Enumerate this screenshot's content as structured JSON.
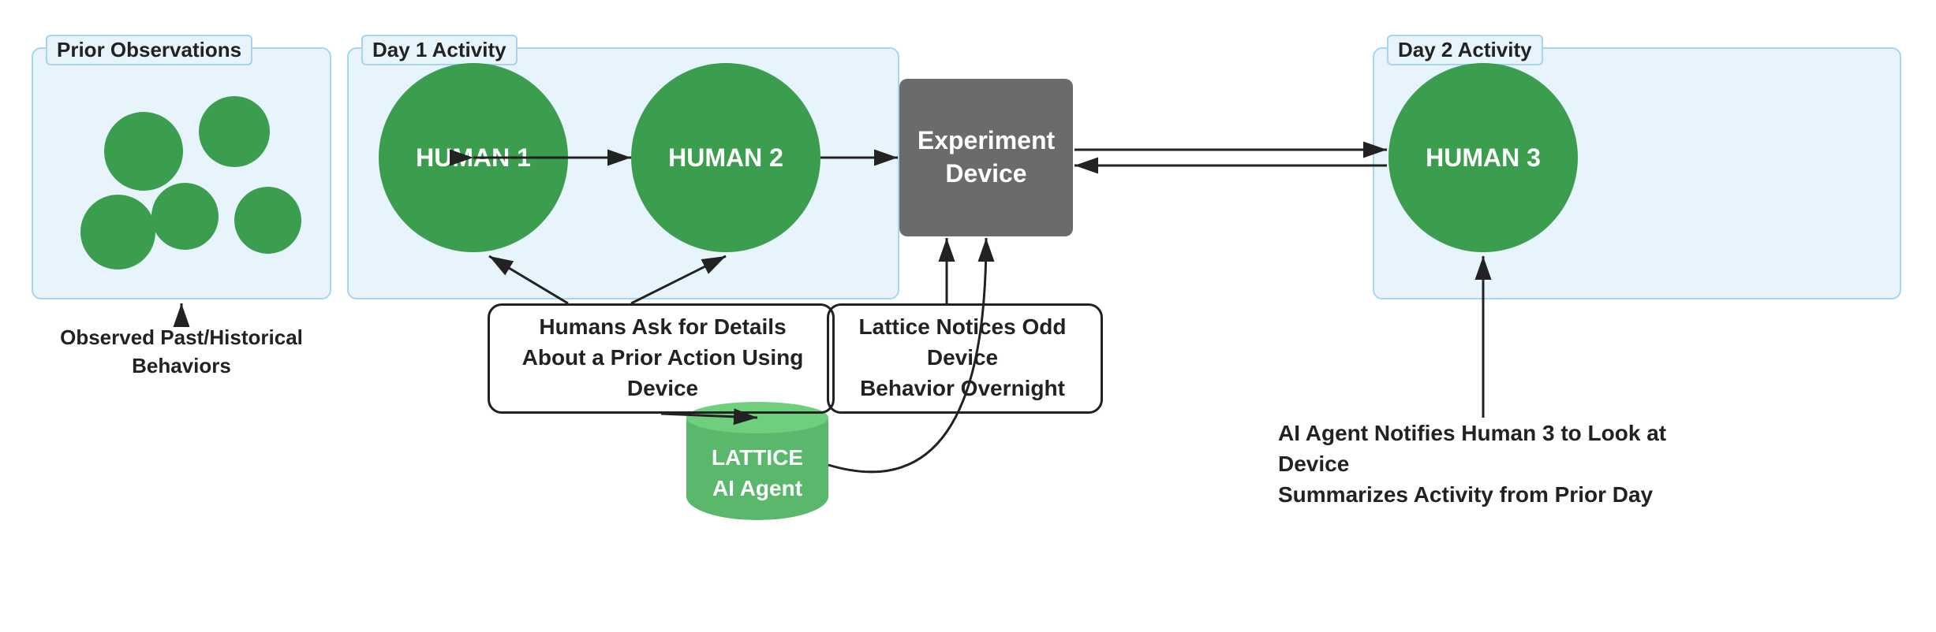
{
  "panels": {
    "prior": {
      "label": "Prior Observations"
    },
    "day1": {
      "label": "Day 1 Activity"
    },
    "day2": {
      "label": "Day 2 Activity"
    }
  },
  "nodes": {
    "human1": "HUMAN 1",
    "human2": "HUMAN 2",
    "human3": "HUMAN 3",
    "device": {
      "line1": "Experiment",
      "line2": "Device"
    },
    "lattice": {
      "line1": "LATTICE",
      "line2": "AI Agent"
    }
  },
  "labels": {
    "observed": "Observed Past/Historical Behaviors",
    "humans_ask_line1": "Humans Ask for Details",
    "humans_ask_line2": "About a Prior Action Using Device",
    "lattice_notices_line1": "Lattice Notices Odd Device",
    "lattice_notices_line2": "Behavior Overnight",
    "ai_agent_line1": "AI Agent Notifies Human 3 to Look at Device",
    "ai_agent_line2": "Summarizes Activity from Prior Day"
  }
}
